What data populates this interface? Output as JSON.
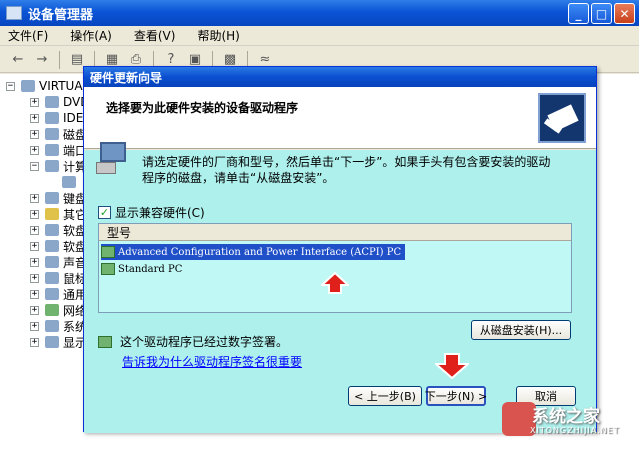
{
  "window": {
    "title": "设备管理器"
  },
  "menu": [
    "文件(F)",
    "操作(A)",
    "查看(V)",
    "帮助(H)"
  ],
  "tree": {
    "root": "VIRTUAL",
    "items": [
      "DVD",
      "IDE",
      "磁盘",
      "端口",
      "计算",
      "",
      "键盘",
      "其它",
      "软盘",
      "软盘",
      "声音",
      "鼠标",
      "通用",
      "网络",
      "系统",
      "显示"
    ]
  },
  "dialog": {
    "title": "硬件更新向导",
    "heading": "选择要为此硬件安装的设备驱动程序",
    "instruction": "请选定硬件的厂商和型号，然后单击“下一步”。如果手头有包含要安装的驱动程序的磁盘，请单击“从磁盘安装”。",
    "compatible_checkbox_label": "显示兼容硬件(C)",
    "compatible_checked": true,
    "list_header": "型号",
    "models": [
      "Advanced Configuration and Power Interface (ACPI) PC",
      "Standard PC"
    ],
    "selected_index": 0,
    "signed_text": "这个驱动程序已经过数字签署。",
    "signature_link": "告诉我为什么驱动程序签名很重要",
    "have_disk_label": "从磁盘安装(H)...",
    "back_label": "< 上一步(B)",
    "next_label": "下一步(N) >",
    "cancel_label": "取消"
  },
  "watermark": {
    "text": "系统之家",
    "sub": "XITONGZHIJIA.NET"
  },
  "colors": {
    "titlebar": "#0a54d6",
    "dialog_body": "#aef0ec",
    "selection": "#1f50c8",
    "annotation_arrow": "#e0201a"
  }
}
